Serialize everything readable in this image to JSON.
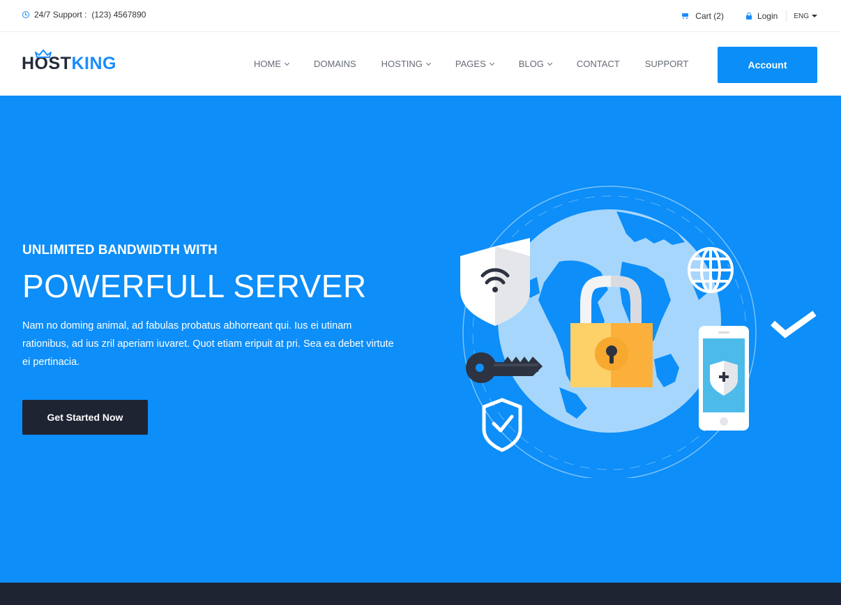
{
  "topbar": {
    "support_label": "24/7 Support :",
    "support_phone": "(123) 4567890",
    "cart_label": "Cart (2)",
    "login_label": "Login",
    "language": "ENG"
  },
  "header": {
    "logo_part1": "HOST",
    "logo_part2": "KING",
    "nav": [
      {
        "label": "HOME"
      },
      {
        "label": "DOMAINS"
      },
      {
        "label": "HOSTING"
      },
      {
        "label": "PAGES"
      },
      {
        "label": "BLOG"
      },
      {
        "label": "CONTACT"
      },
      {
        "label": "SUPPORT"
      }
    ],
    "account_label": "Account"
  },
  "hero": {
    "subtitle": "UNLIMITED BANDWIDTH WITH",
    "title": "POWERFULL SERVER",
    "text": "Nam no doming animal, ad fabulas probatus abhorreant qui. Ius ei utinam rationibus, ad ius zril aperiam iuvaret. Quot etiam eripuit at pri. Sea ea debet virtute ei pertinacia.",
    "cta_label": "Get Started Now"
  },
  "colors": {
    "primary": "#0d8ef8",
    "dark": "#1f2433",
    "text": "#333333",
    "nav_text": "#656b76"
  },
  "icons": [
    "clock-icon",
    "cart-icon",
    "lock-icon",
    "caret-down-icon",
    "crown-icon",
    "chevron-down-icon",
    "shield-wifi-icon",
    "key-icon",
    "padlock-icon",
    "globe-icon",
    "phone-shield-icon",
    "shield-check-icon",
    "checkmark-icon",
    "world-map-icon"
  ]
}
